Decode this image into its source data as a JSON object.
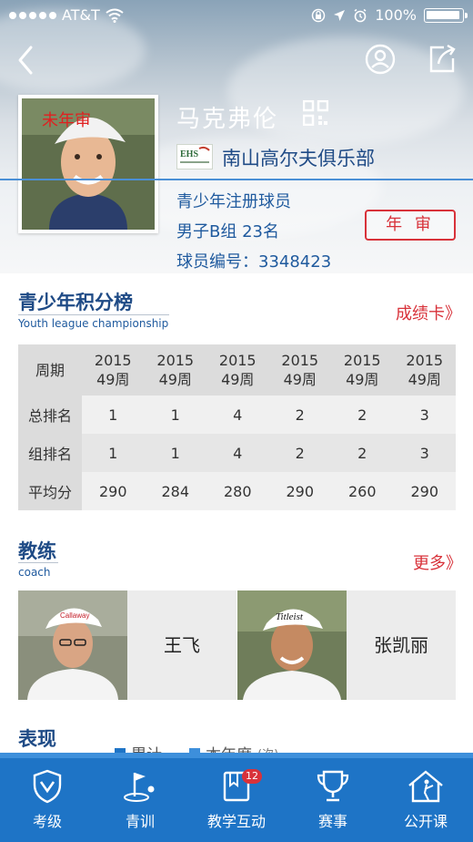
{
  "status_bar": {
    "carrier": "AT&T",
    "time": "",
    "battery": "100%"
  },
  "profile": {
    "name": "马克弗伦",
    "avatar_badge": "未年审",
    "club": "南山高尔夫俱乐部",
    "club_logo_text": "EHS",
    "registration": "青少年注册球员",
    "group_rank": "男子B组  23名",
    "player_no": "球员编号：3348423",
    "review_button": "年 审"
  },
  "league": {
    "title": "青少年积分榜",
    "subtitle": "Youth league championship",
    "more": "成绩卡》",
    "header_label": "周期",
    "periods": [
      {
        "year": "2015",
        "week": "49周"
      },
      {
        "year": "2015",
        "week": "49周"
      },
      {
        "year": "2015",
        "week": "49周"
      },
      {
        "year": "2015",
        "week": "49周"
      },
      {
        "year": "2015",
        "week": "49周"
      },
      {
        "year": "2015",
        "week": "49周"
      }
    ],
    "rows": [
      {
        "label": "总排名",
        "values": [
          "1",
          "1",
          "4",
          "2",
          "2",
          "3"
        ]
      },
      {
        "label": "组排名",
        "values": [
          "1",
          "1",
          "4",
          "2",
          "2",
          "3"
        ]
      },
      {
        "label": "平均分",
        "values": [
          "290",
          "284",
          "280",
          "290",
          "260",
          "290"
        ]
      }
    ]
  },
  "coach": {
    "title": "教练",
    "subtitle": "coach",
    "more": "更多》",
    "items": [
      {
        "name": "王飞",
        "cap_brand": "Callaway"
      },
      {
        "name": "张凯丽",
        "cap_brand": "Titleist"
      }
    ]
  },
  "performance": {
    "title": "表现",
    "legend": [
      {
        "label": "累计",
        "color": "#1e74c6"
      },
      {
        "label": "本年度",
        "color": "#3d8fdb"
      }
    ],
    "unit": "(次)"
  },
  "tabs": [
    {
      "label": "考级",
      "icon": "shield-check-icon"
    },
    {
      "label": "青训",
      "icon": "golf-flag-icon"
    },
    {
      "label": "教学互动",
      "icon": "book-icon",
      "badge": "12"
    },
    {
      "label": "赛事",
      "icon": "trophy-icon"
    },
    {
      "label": "公开课",
      "icon": "house-golfer-icon"
    }
  ],
  "colors": {
    "accent": "#1e74c6",
    "brand_text": "#1f4b86",
    "alert": "#d8323a"
  }
}
